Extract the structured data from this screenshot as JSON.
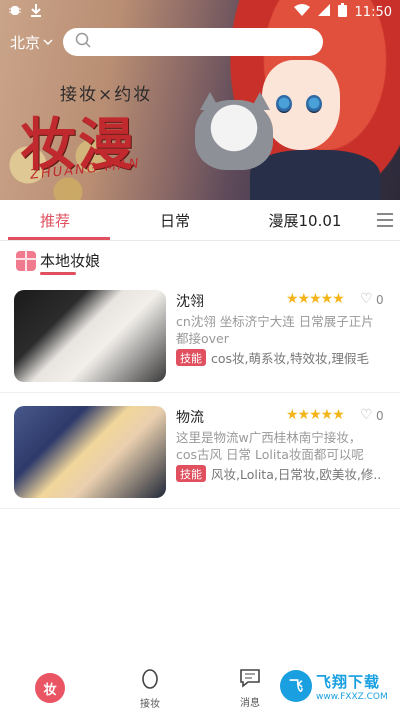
{
  "status_bar": {
    "time": "11:50"
  },
  "location": {
    "city": "北京"
  },
  "search": {
    "placeholder": ""
  },
  "banner": {
    "subtitle": "接妆×约妆",
    "title": "妆漫",
    "roman": "ZHUANG MAN"
  },
  "tabs": [
    {
      "label": "推荐",
      "active": true
    },
    {
      "label": "日常",
      "active": false
    },
    {
      "label": "漫展10.01",
      "active": false
    }
  ],
  "section": {
    "title": "本地妆娘"
  },
  "list": [
    {
      "name": "沈翎",
      "rating": "★★★★★",
      "likes": "0",
      "description": "cn沈翎 坐标济宁大连 日常展子正片都接over",
      "tag": "技能",
      "skills": "cos妆,萌系妆,特效妆,理假毛"
    },
    {
      "name": "物流",
      "rating": "★★★★★",
      "likes": "0",
      "description": "这里是物流w广西桂林南宁接妆，cos古风 日常 Lolita妆面都可以呢",
      "tag": "技能",
      "skills": "风妆,Lolita,日常妆,欧美妆,修..."
    }
  ],
  "bottom_nav": [
    {
      "label": "",
      "icon": "home-logo",
      "badge": "妆"
    },
    {
      "label": "接妆",
      "icon": "egg-icon"
    },
    {
      "label": "消息",
      "icon": "message-icon"
    }
  ],
  "watermark": {
    "cn": "飞翔下载",
    "en": "www.FXXZ.COM",
    "logo": "飞"
  },
  "colors": {
    "accent": "#e0505f",
    "star": "#f3b519"
  }
}
